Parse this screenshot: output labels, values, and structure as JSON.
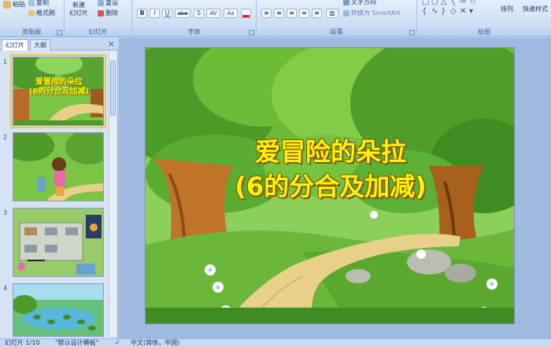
{
  "ribbon": {
    "clipboard": {
      "paste_label": "粘贴",
      "copy_label": "复制",
      "format_painter_label": "格式刷",
      "group_label": "剪贴板"
    },
    "slides": {
      "new_slide_label": "新建\n幻灯片",
      "reset_label": "重设",
      "delete_label": "删除",
      "group_label": "幻灯片"
    },
    "font": {
      "group_label": "字体",
      "bold": "B",
      "italic": "I",
      "underline": "U",
      "strike": "abe",
      "shadow": "S",
      "spacing": "AV",
      "case": "Aa"
    },
    "paragraph": {
      "group_label": "段落",
      "text_direction_label": "文字方向",
      "align_text_label": "对齐文本",
      "smartart_label": "转换为 SmartArt"
    },
    "drawing": {
      "group_label": "绘图",
      "arrange_label": "排列",
      "quick_styles_label": "快速样式"
    }
  },
  "left_pane": {
    "tabs": [
      {
        "label": "幻灯片"
      },
      {
        "label": "大纲"
      }
    ],
    "close_symbol": "×",
    "thumbnails": [
      {
        "number": "1",
        "title_line1": "爱冒险的朵拉",
        "title_line2": "(6的分合及加减)"
      },
      {
        "number": "2"
      },
      {
        "number": "3"
      },
      {
        "number": "4"
      }
    ]
  },
  "slide": {
    "title_line1": "爱冒险的朵拉",
    "title_line2": "(6的分合及加减)"
  },
  "status_bar": {
    "slide_counter": "幻灯片 1/10",
    "theme": "\"默认设计模板\"",
    "language": "中文(简体，中国)"
  },
  "colors": {
    "title_text": "#fff200",
    "ribbon_bg": "#cddff6",
    "grass": "#6cb83a",
    "path": "#e8d08a"
  }
}
